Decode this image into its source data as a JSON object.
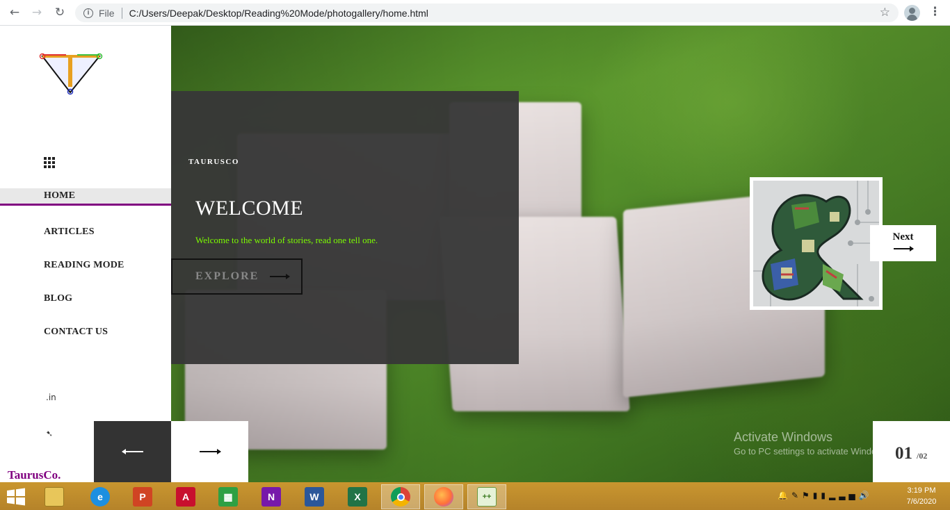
{
  "browser": {
    "scheme": "File",
    "url": "C:/Users/Deepak/Desktop/Reading%20Mode/photogallery/home.html"
  },
  "sidebar": {
    "nav": [
      {
        "label": "HOME",
        "active": true
      },
      {
        "label": "ARTICLES"
      },
      {
        "label": "READING MODE"
      },
      {
        "label": "BLOG"
      },
      {
        "label": "CONTACT US"
      }
    ],
    "brand": "TaurusCo."
  },
  "hero": {
    "kicker": "TAURUSCO",
    "title": "WELCOME",
    "subtitle": "Welcome to the world of stories, read one tell one.",
    "explore_label": "EXPLORE",
    "next_label": "Next"
  },
  "slider": {
    "current": "01",
    "total": "/02"
  },
  "watermark": {
    "title": "Activate Windows",
    "subtitle": "Go to PC settings to activate Windows."
  },
  "taskbar": {
    "apps": [
      "file-explorer",
      "internet-explorer",
      "powerpoint",
      "acrobat",
      "store",
      "onenote",
      "word",
      "excel",
      "chrome",
      "firefox",
      "notepad-plus-plus"
    ],
    "active_app": "chrome",
    "time": "3:19 PM",
    "date": "7/6/2020"
  },
  "colors": {
    "accent": "#800080",
    "subtitle": "#7cfc00",
    "panel": "#373737",
    "taskbar": "#c0902e"
  }
}
